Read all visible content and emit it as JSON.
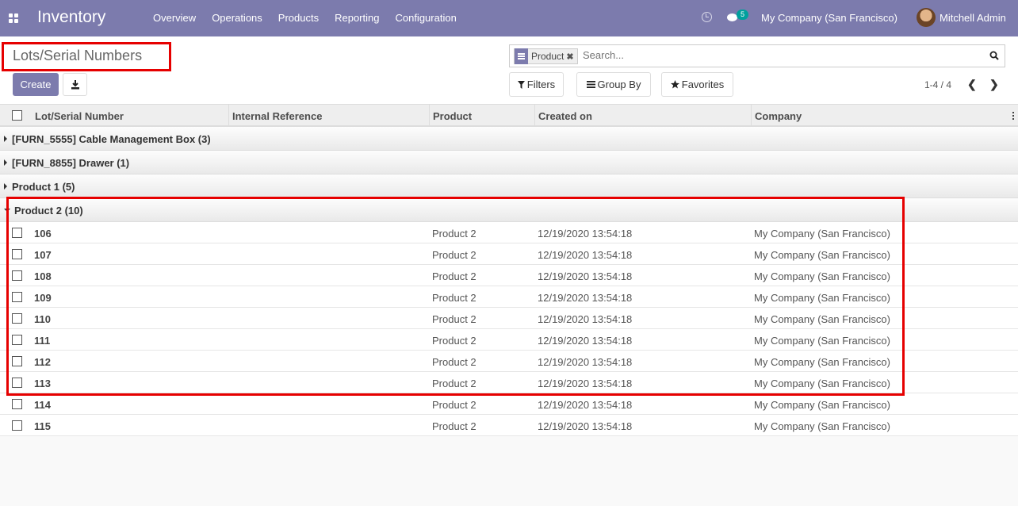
{
  "navbar": {
    "app_title": "Inventory",
    "menu": [
      "Overview",
      "Operations",
      "Products",
      "Reporting",
      "Configuration"
    ],
    "chat_badge": "5",
    "company": "My Company (San Francisco)",
    "user": "Mitchell Admin"
  },
  "control_panel": {
    "breadcrumb": "Lots/Serial Numbers",
    "create_label": "Create",
    "search": {
      "facet_label": "Product",
      "facet_remove": "✖",
      "placeholder": "Search..."
    },
    "filters_label": "Filters",
    "groupby_label": "Group By",
    "favorites_label": "Favorites",
    "pager": "1-4 / 4",
    "pager_prev": "❮",
    "pager_next": "❯"
  },
  "table": {
    "columns": [
      "Lot/Serial Number",
      "Internal Reference",
      "Product",
      "Created on",
      "Company"
    ],
    "groups": [
      {
        "label": "[FURN_5555] Cable Management Box (3)",
        "open": false
      },
      {
        "label": "[FURN_8855] Drawer (1)",
        "open": false
      },
      {
        "label": "Product 1 (5)",
        "open": false
      },
      {
        "label": "Product 2 (10)",
        "open": true
      }
    ],
    "rows": [
      {
        "lot": "106",
        "ref": "",
        "product": "Product 2",
        "created": "12/19/2020 13:54:18",
        "company": "My Company (San Francisco)"
      },
      {
        "lot": "107",
        "ref": "",
        "product": "Product 2",
        "created": "12/19/2020 13:54:18",
        "company": "My Company (San Francisco)"
      },
      {
        "lot": "108",
        "ref": "",
        "product": "Product 2",
        "created": "12/19/2020 13:54:18",
        "company": "My Company (San Francisco)"
      },
      {
        "lot": "109",
        "ref": "",
        "product": "Product 2",
        "created": "12/19/2020 13:54:18",
        "company": "My Company (San Francisco)"
      },
      {
        "lot": "110",
        "ref": "",
        "product": "Product 2",
        "created": "12/19/2020 13:54:18",
        "company": "My Company (San Francisco)"
      },
      {
        "lot": "111",
        "ref": "",
        "product": "Product 2",
        "created": "12/19/2020 13:54:18",
        "company": "My Company (San Francisco)"
      },
      {
        "lot": "112",
        "ref": "",
        "product": "Product 2",
        "created": "12/19/2020 13:54:18",
        "company": "My Company (San Francisco)"
      },
      {
        "lot": "113",
        "ref": "",
        "product": "Product 2",
        "created": "12/19/2020 13:54:18",
        "company": "My Company (San Francisco)"
      },
      {
        "lot": "114",
        "ref": "",
        "product": "Product 2",
        "created": "12/19/2020 13:54:18",
        "company": "My Company (San Francisco)"
      },
      {
        "lot": "115",
        "ref": "",
        "product": "Product 2",
        "created": "12/19/2020 13:54:18",
        "company": "My Company (San Francisco)"
      }
    ]
  }
}
